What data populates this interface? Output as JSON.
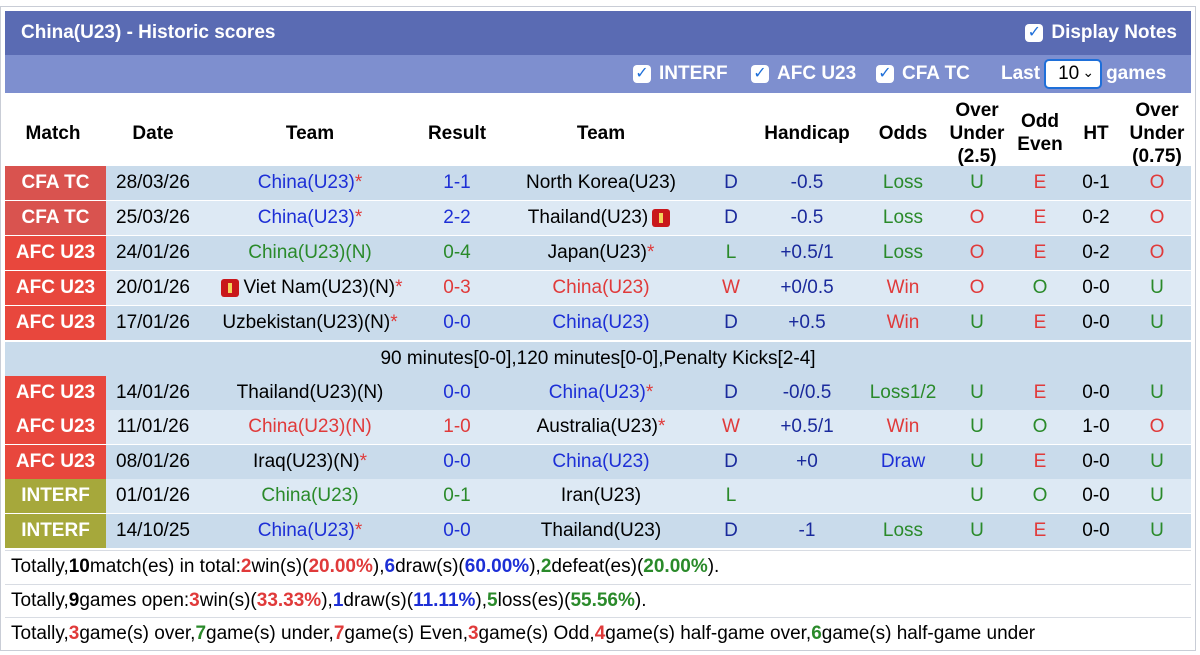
{
  "header": {
    "title": "China(U23) - Historic scores",
    "display_notes": "Display Notes"
  },
  "filters": {
    "interf": "INTERF",
    "afc": "AFC U23",
    "cfa": "CFA TC",
    "last_label": "Last",
    "last_value": "10",
    "games_label": "games"
  },
  "columns": {
    "match": "Match",
    "date": "Date",
    "team": "Team",
    "result": "Result",
    "team2": "Team",
    "handicap": "Handicap",
    "odds": "Odds",
    "ou_a": "Over",
    "ou_b": "Under",
    "ou_c": "(2.5)",
    "oe_a": "Odd",
    "oe_b": "Even",
    "ht": "HT",
    "ou2_a": "Over",
    "ou2_b": "Under",
    "ou2_c": "(0.75)"
  },
  "colors": {
    "cfa": "#d9534f",
    "afc": "#e8473d",
    "interf": "#a6a83b"
  },
  "rows": [
    {
      "match": "CFA TC",
      "date": "28/03/26",
      "home": "China(U23)",
      "home_mark": "*",
      "home_color": "blue",
      "score_a": "1",
      "score_b": "1",
      "score_color": "blue",
      "away": "North Korea(U23)",
      "away_mark": "",
      "away_color": "dk",
      "wdl": "D",
      "wdl_color": "navy",
      "handicap": "-0.5",
      "odds": "Loss",
      "odds_color": "green",
      "ou": "U",
      "ou_color": "green",
      "oe": "E",
      "oe_color": "red",
      "ht": "0-1",
      "ou2": "O",
      "ou2_color": "red",
      "badge": "cfa"
    },
    {
      "match": "CFA TC",
      "date": "25/03/26",
      "home": "China(U23)",
      "home_mark": "*",
      "home_color": "blue",
      "score_a": "2",
      "score_b": "2",
      "score_color": "blue",
      "away": "Thailand(U23)",
      "away_mark": "",
      "away_color": "dk",
      "away_flag": true,
      "wdl": "D",
      "wdl_color": "navy",
      "handicap": "-0.5",
      "odds": "Loss",
      "odds_color": "green",
      "ou": "O",
      "ou_color": "red",
      "oe": "E",
      "oe_color": "red",
      "ht": "0-2",
      "ou2": "O",
      "ou2_color": "red",
      "badge": "cfa"
    },
    {
      "match": "AFC U23",
      "date": "24/01/26",
      "home": "China(U23)(N)",
      "home_mark": "",
      "home_color": "green",
      "score_a": "0",
      "score_b": "4",
      "score_color": "green",
      "away": "Japan(U23)",
      "away_mark": "*",
      "away_color": "dk",
      "wdl": "L",
      "wdl_color": "green",
      "handicap": "+0.5/1",
      "odds": "Loss",
      "odds_color": "green",
      "ou": "O",
      "ou_color": "red",
      "oe": "E",
      "oe_color": "red",
      "ht": "0-2",
      "ou2": "O",
      "ou2_color": "red",
      "badge": "afc"
    },
    {
      "match": "AFC U23",
      "date": "20/01/26",
      "home": "Viet Nam(U23)(N)",
      "home_mark": "*",
      "home_color": "dk",
      "home_flag": true,
      "score_a": "0",
      "score_b": "3",
      "score_color": "red",
      "away": "China(U23)",
      "away_mark": "",
      "away_color": "red",
      "wdl": "W",
      "wdl_color": "red",
      "handicap": "+0/0.5",
      "odds": "Win",
      "odds_color": "red",
      "ou": "O",
      "ou_color": "red",
      "oe": "O",
      "oe_color": "green",
      "ht": "0-0",
      "ou2": "U",
      "ou2_color": "green",
      "badge": "afc"
    },
    {
      "match": "AFC U23",
      "date": "17/01/26",
      "home": "Uzbekistan(U23)(N)",
      "home_mark": "*",
      "home_color": "dk",
      "score_a": "0",
      "score_b": "0",
      "score_color": "blue",
      "away": "China(U23)",
      "away_mark": "",
      "away_color": "blue",
      "wdl": "D",
      "wdl_color": "navy",
      "handicap": "+0.5",
      "odds": "Win",
      "odds_color": "red",
      "ou": "U",
      "ou_color": "green",
      "oe": "E",
      "oe_color": "red",
      "ht": "0-0",
      "ou2": "U",
      "ou2_color": "green",
      "badge": "afc"
    },
    {
      "match": "AFC U23",
      "date": "14/01/26",
      "home": "Thailand(U23)(N)",
      "home_mark": "",
      "home_color": "dk",
      "score_a": "0",
      "score_b": "0",
      "score_color": "blue",
      "away": "China(U23)",
      "away_mark": "*",
      "away_color": "blue",
      "wdl": "D",
      "wdl_color": "navy",
      "handicap": "-0/0.5",
      "odds": "Loss1/2",
      "odds_color": "green",
      "ou": "U",
      "ou_color": "green",
      "oe": "E",
      "oe_color": "red",
      "ht": "0-0",
      "ou2": "U",
      "ou2_color": "green",
      "badge": "afc"
    },
    {
      "match": "AFC U23",
      "date": "11/01/26",
      "home": "China(U23)(N)",
      "home_mark": "",
      "home_color": "red",
      "score_a": "1",
      "score_b": "0",
      "score_color": "red",
      "away": "Australia(U23)",
      "away_mark": "*",
      "away_color": "dk",
      "wdl": "W",
      "wdl_color": "red",
      "handicap": "+0.5/1",
      "odds": "Win",
      "odds_color": "red",
      "ou": "U",
      "ou_color": "green",
      "oe": "O",
      "oe_color": "green",
      "ht": "1-0",
      "ou2": "O",
      "ou2_color": "red",
      "badge": "afc"
    },
    {
      "match": "AFC U23",
      "date": "08/01/26",
      "home": "Iraq(U23)(N)",
      "home_mark": "*",
      "home_color": "dk",
      "score_a": "0",
      "score_b": "0",
      "score_color": "blue",
      "away": "China(U23)",
      "away_mark": "",
      "away_color": "blue",
      "wdl": "D",
      "wdl_color": "navy",
      "handicap": "+0",
      "odds": "Draw",
      "odds_color": "blue",
      "ou": "U",
      "ou_color": "green",
      "oe": "E",
      "oe_color": "red",
      "ht": "0-0",
      "ou2": "U",
      "ou2_color": "green",
      "badge": "afc"
    },
    {
      "match": "INTERF",
      "date": "01/01/26",
      "home": "China(U23)",
      "home_mark": "",
      "home_color": "green",
      "score_a": "0",
      "score_b": "1",
      "score_color": "green",
      "away": "Iran(U23)",
      "away_mark": "",
      "away_color": "dk",
      "wdl": "L",
      "wdl_color": "green",
      "handicap": "",
      "odds": "",
      "odds_color": "green",
      "ou": "U",
      "ou_color": "green",
      "oe": "O",
      "oe_color": "green",
      "ht": "0-0",
      "ou2": "U",
      "ou2_color": "green",
      "badge": "interf"
    },
    {
      "match": "INTERF",
      "date": "14/10/25",
      "home": "China(U23)",
      "home_mark": "*",
      "home_color": "blue",
      "score_a": "0",
      "score_b": "0",
      "score_color": "blue",
      "away": "Thailand(U23)",
      "away_mark": "",
      "away_color": "dk",
      "wdl": "D",
      "wdl_color": "navy",
      "handicap": "-1",
      "odds": "Loss",
      "odds_color": "green",
      "ou": "U",
      "ou_color": "green",
      "oe": "E",
      "oe_color": "red",
      "ht": "0-0",
      "ou2": "U",
      "ou2_color": "green",
      "badge": "interf"
    }
  ],
  "note": "90 minutes[0-0],120 minutes[0-0],Penalty Kicks[2-4]",
  "summary": {
    "l1": {
      "p1": "Totally, ",
      "n1": "10",
      "p2": " match(es) in total: ",
      "w": "2",
      "p3": " win(s)(",
      "wp": "20.00%",
      "p4": "), ",
      "d": "6",
      "p5": " draw(s)(",
      "dp": "60.00%",
      "p6": "), ",
      "l": "2",
      "p7": " defeat(es)(",
      "lp": "20.00%",
      "p8": ")."
    },
    "l2": {
      "p1": "Totally, ",
      "n1": "9",
      "p2": " games open: ",
      "w": "3",
      "p3": " win(s)(",
      "wp": "33.33%",
      "p4": "), ",
      "d": "1",
      "p5": " draw(s)(",
      "dp": "11.11%",
      "p6": "), ",
      "l": "5",
      "p7": " loss(es)(",
      "lp": "55.56%",
      "p8": ")."
    },
    "l3": {
      "p1": "Totally, ",
      "o": "3",
      "p2": " game(s) over, ",
      "u": "7",
      "p3": " game(s) under, ",
      "e": "7",
      "p4": " game(s) Even, ",
      "od": "3",
      "p5": " game(s) Odd, ",
      "hgo": "4",
      "p6": " game(s) half-game over, ",
      "hgu": "6",
      "p7": " game(s) half-game under"
    }
  }
}
